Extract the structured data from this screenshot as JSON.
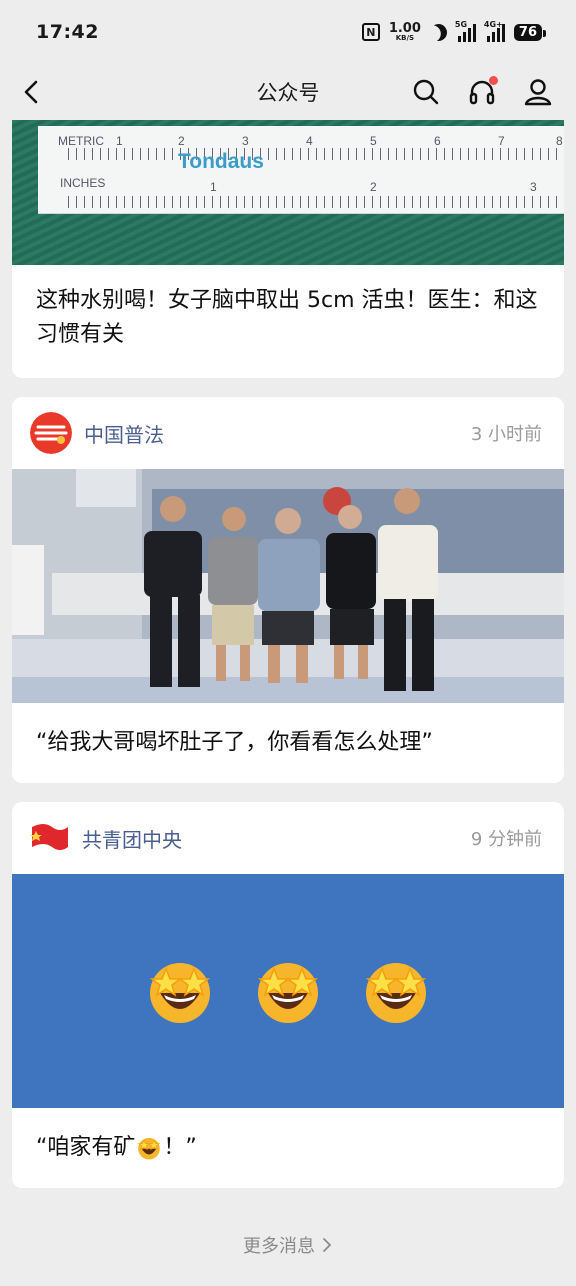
{
  "status_bar": {
    "time": "17:42",
    "net_speed": "1.00",
    "net_unit": "KB/S",
    "sim1": "5G",
    "sim2": "4G+",
    "battery": "76"
  },
  "nav": {
    "title": "公众号",
    "back_icon": "chevron-left-icon",
    "search_icon": "search-icon",
    "audio_icon": "headphones-icon",
    "profile_icon": "user-icon",
    "notification_dot_color": "#f24e4e"
  },
  "articles": [
    {
      "image": {
        "ruler_metric_label": "METRIC",
        "ruler_inches_label": "INCHES",
        "ruler_brand": "Tondaus",
        "metric_numbers": [
          "1",
          "2",
          "3",
          "4",
          "5",
          "6",
          "7",
          "8"
        ],
        "inch_numbers": [
          "1",
          "2",
          "3"
        ]
      },
      "title": "这种水别喝！女子脑中取出 5cm 活虫！医生：和这习惯有关"
    },
    {
      "account": "中国普法",
      "time": "3 小时前",
      "title": "“给我大哥喝坏肚子了，你看看怎么处理”"
    },
    {
      "account": "共青团中央",
      "time": "9 分钟前",
      "image": {
        "emojis": [
          "star-struck",
          "star-struck",
          "star-struck"
        ],
        "background": "#3f74bf"
      },
      "title_prefix": "“咱家有矿",
      "title_suffix": "！”"
    }
  ],
  "footer": {
    "more_label": "更多消息"
  },
  "colors": {
    "account_name": "#4a5f8f",
    "timestamp": "#9b9b9b",
    "page_bg": "#ededed"
  }
}
